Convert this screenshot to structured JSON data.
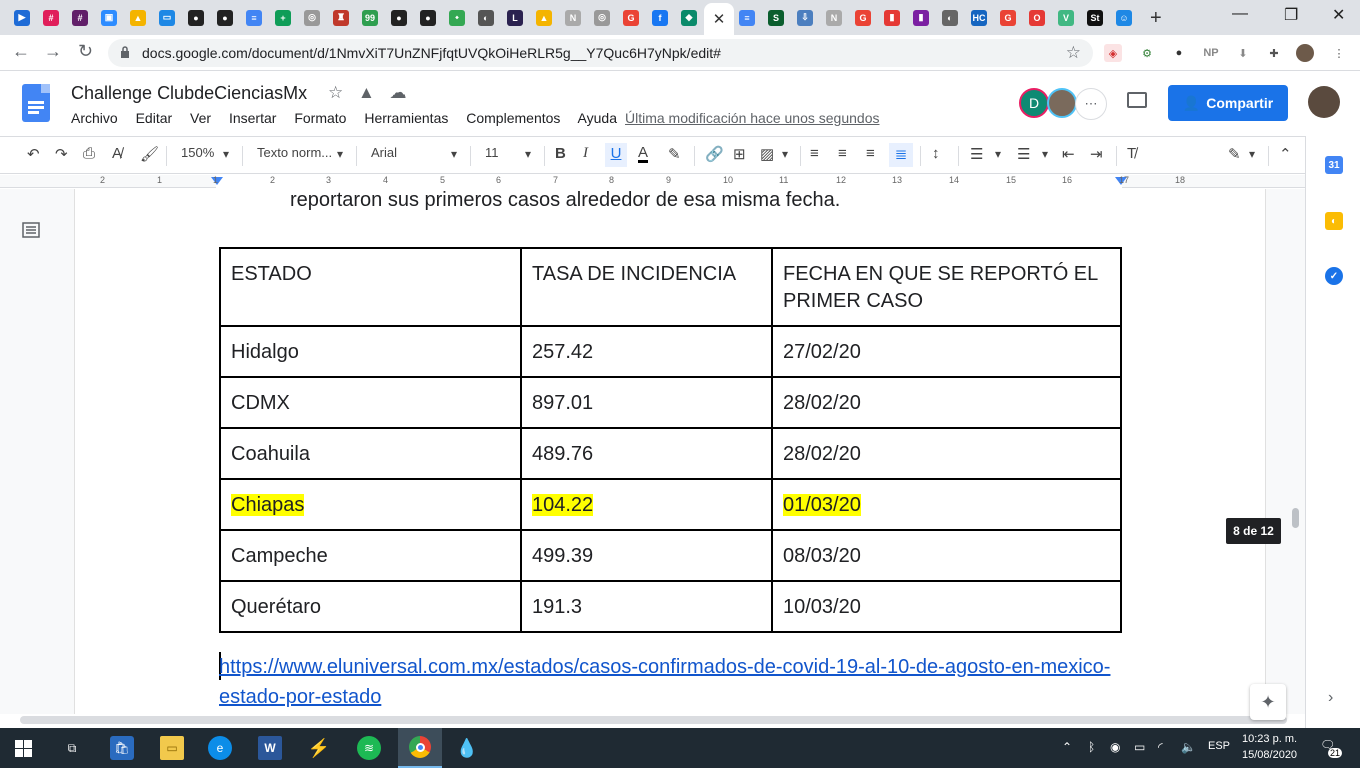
{
  "browser": {
    "tabs": [
      {
        "icon": "media-icon",
        "color": "#1e6bd6",
        "glyph": "▶"
      },
      {
        "icon": "slack-icon",
        "color": "#e01e5a",
        "glyph": "#"
      },
      {
        "icon": "slack-icon",
        "color": "#611f69",
        "glyph": "#"
      },
      {
        "icon": "zoom-icon",
        "color": "#2d8cff",
        "glyph": "▣"
      },
      {
        "icon": "drive-icon",
        "color": "#f4b400",
        "glyph": "▲"
      },
      {
        "icon": "classroom-icon",
        "color": "#1e88e5",
        "glyph": "▭"
      },
      {
        "icon": "github-icon",
        "color": "#222222",
        "glyph": "●"
      },
      {
        "icon": "github-icon",
        "color": "#222222",
        "glyph": "●"
      },
      {
        "icon": "docs-icon",
        "color": "#4285f4",
        "glyph": "≡"
      },
      {
        "icon": "sheets-icon",
        "color": "#0f9d58",
        "glyph": "+"
      },
      {
        "icon": "site-icon",
        "color": "#999999",
        "glyph": "◎"
      },
      {
        "icon": "site-icon",
        "color": "#c0392b",
        "glyph": "♜"
      },
      {
        "icon": "badge-icon",
        "color": "#2e9e4f",
        "glyph": "99"
      },
      {
        "icon": "github-icon",
        "color": "#222222",
        "glyph": "●"
      },
      {
        "icon": "github-icon",
        "color": "#222222",
        "glyph": "●"
      },
      {
        "icon": "maps-icon",
        "color": "#34a853",
        "glyph": "⬩"
      },
      {
        "icon": "site-icon",
        "color": "#555555",
        "glyph": "◐"
      },
      {
        "icon": "letter-l-icon",
        "color": "#2b2250",
        "glyph": "L"
      },
      {
        "icon": "drive-icon",
        "color": "#f4b400",
        "glyph": "▲"
      },
      {
        "icon": "notion-icon",
        "color": "#aaaaaa",
        "glyph": "N"
      },
      {
        "icon": "site-icon",
        "color": "#999999",
        "glyph": "◎"
      },
      {
        "icon": "google-icon",
        "color": "#ea4335",
        "glyph": "G"
      },
      {
        "icon": "facebook-icon",
        "color": "#1877f2",
        "glyph": "f"
      },
      {
        "icon": "diamond-icon",
        "color": "#0a8a6a",
        "glyph": "◆"
      },
      {
        "icon": "close-tab-icon",
        "color": "#ffffff",
        "glyph": "✕"
      },
      {
        "icon": "docs-icon",
        "color": "#4285f4",
        "glyph": "≡"
      },
      {
        "icon": "site-icon",
        "color": "#0b5e2e",
        "glyph": "S"
      },
      {
        "icon": "site-icon",
        "color": "#4c7fbf",
        "glyph": "⇩"
      },
      {
        "icon": "notion-icon",
        "color": "#aaaaaa",
        "glyph": "N"
      },
      {
        "icon": "google-icon",
        "color": "#ea4335",
        "glyph": "G"
      },
      {
        "icon": "bookmark-icon",
        "color": "#e53935",
        "glyph": "▮"
      },
      {
        "icon": "bookmark-icon",
        "color": "#7b1fa2",
        "glyph": "▮"
      },
      {
        "icon": "site-icon",
        "color": "#666666",
        "glyph": "◐"
      },
      {
        "icon": "site-icon",
        "color": "#1565c0",
        "glyph": "HC"
      },
      {
        "icon": "google-icon",
        "color": "#ea4335",
        "glyph": "G"
      },
      {
        "icon": "opera-icon",
        "color": "#e53935",
        "glyph": "O"
      },
      {
        "icon": "vue-icon",
        "color": "#41b883",
        "glyph": "V"
      },
      {
        "icon": "site-icon",
        "color": "#111111",
        "glyph": "St"
      },
      {
        "icon": "bot-icon",
        "color": "#1e88e5",
        "glyph": "☺"
      }
    ],
    "new_tab_label": "+",
    "url": "docs.google.com/document/d/1NmvXiT7UnZNFjfqtUVQkOiHeRLR5g__Y7Quc6H7yNpk/edit#"
  },
  "docs": {
    "title": "Challenge ClubdeCienciasMx",
    "menu": [
      "Archivo",
      "Editar",
      "Ver",
      "Insertar",
      "Formato",
      "Herramientas",
      "Complementos",
      "Ayuda"
    ],
    "last_modified": "Última modificación hace unos segundos",
    "share_label": "Compartir",
    "collaborator_initial": "D",
    "toolbar": {
      "zoom": "150%",
      "style": "Texto norm...",
      "font": "Arial",
      "size": "11"
    },
    "ruler_numbers": [
      "2",
      "1",
      "1",
      "2",
      "3",
      "4",
      "5",
      "6",
      "7",
      "8",
      "9",
      "10",
      "11",
      "12",
      "13",
      "14",
      "15",
      "16",
      "17",
      "18"
    ]
  },
  "document": {
    "intro_text": "reportaron sus primeros casos alrededor de esa misma fecha.",
    "table": {
      "headers": [
        "ESTADO",
        "TASA DE INCIDENCIA",
        "FECHA EN QUE SE REPORTÓ EL PRIMER CASO"
      ],
      "rows": [
        {
          "estado": "Hidalgo",
          "tasa": "257.42",
          "fecha": "27/02/20",
          "highlight": false
        },
        {
          "estado": "CDMX",
          "tasa": "897.01",
          "fecha": "28/02/20",
          "highlight": false
        },
        {
          "estado": "Coahuila",
          "tasa": "489.76",
          "fecha": "28/02/20",
          "highlight": false
        },
        {
          "estado": "Chiapas",
          "tasa": "104.22",
          "fecha": "01/03/20",
          "highlight": true
        },
        {
          "estado": "Campeche",
          "tasa": "499.39",
          "fecha": "08/03/20",
          "highlight": false
        },
        {
          "estado": "Querétaro",
          "tasa": "191.3",
          "fecha": "10/03/20",
          "highlight": false
        }
      ]
    },
    "link": "https://www.eluniversal.com.mx/estados/casos-confirmados-de-covid-19-al-10-de-agosto-en-mexico-estado-por-estado",
    "page_indicator": "8 de 12"
  },
  "taskbar": {
    "language": "ESP",
    "time": "10:23 p. m.",
    "date": "15/08/2020",
    "notifications": "21"
  }
}
